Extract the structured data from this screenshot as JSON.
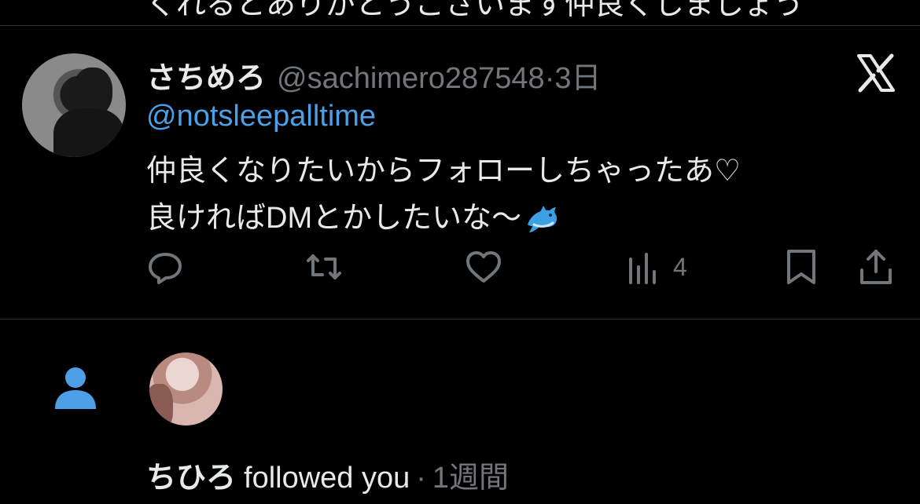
{
  "previous_item": {
    "clipped_text": "くれるとありがとうございます仲良くしましょう"
  },
  "tweet": {
    "display_name": "さちめろ",
    "handle": "@sachimero287548",
    "separator": "·",
    "time": "3日",
    "mention": "@notsleepalltime",
    "line1": "仲良くなりたいからフォローしちゃったあ♡",
    "line2": "良ければDMとかしたいな〜",
    "line2_emoji": "dolphin-emoji",
    "source_icon": "x-logo-icon",
    "actions": {
      "reply_icon": "reply-icon",
      "repost_icon": "repost-icon",
      "like_icon": "like-icon",
      "views_icon": "views-icon",
      "views_count": "4",
      "bookmark_icon": "bookmark-icon",
      "share_icon": "share-icon"
    }
  },
  "follow_notification": {
    "icon": "person-icon",
    "user_name": "ちひろ",
    "action": "followed you",
    "separator": "·",
    "time": "1週間"
  },
  "colors": {
    "background": "#000000",
    "text": "#e7e9ea",
    "secondary": "#71767b",
    "accent": "#4d9fe6",
    "divider": "#2f3336"
  }
}
